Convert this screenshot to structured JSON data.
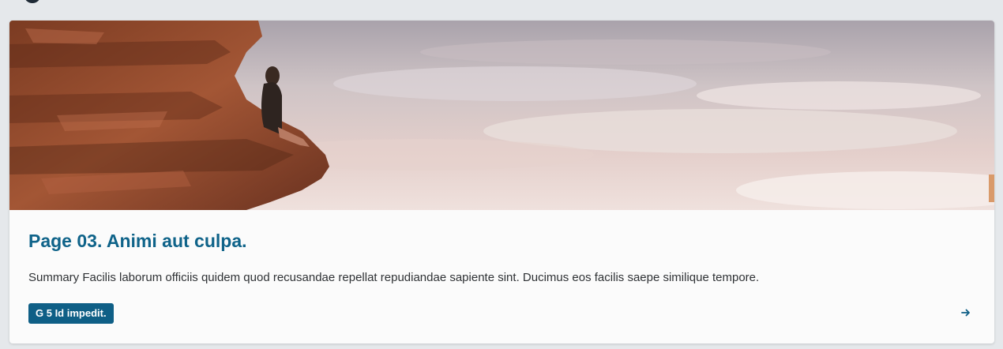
{
  "card": {
    "title": "Page 03. Animi aut culpa.",
    "summary": "Summary Facilis laborum officiis quidem quod recusandae repellat repudiandae sapiente sint. Ducimus eos facilis saepe similique tempore.",
    "tag_label": "G 5 Id impedit.",
    "link_icon": "arrow-right-icon",
    "hero_image": "hero-image"
  },
  "colors": {
    "title": "#0f6389",
    "tag_background": "#0f5f86",
    "page_background": "#e5e8eb",
    "card_background": "#fbfbfb"
  }
}
